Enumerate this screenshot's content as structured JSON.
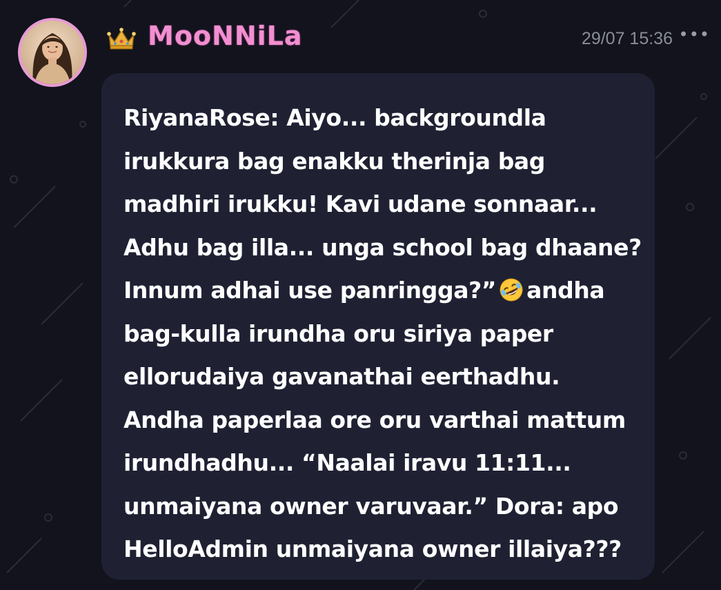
{
  "post": {
    "author": "MooNNiLa",
    "timestamp": "29/07 15:36",
    "more_icon": "more-horizontal-icon",
    "badge_icon": "crown-icon",
    "message_lines": [
      "RiyanaRose: Aiyo... backgroundla",
      "irukkura bag enakku therinja bag",
      "madhiri irukku! Kavi udane sonnaar...",
      "Adhu bag illa... unga school bag dhaane?",
      "Innum adhai use panringga?”",
      "andha",
      "bag-kulla irundha oru siriya paper",
      "ellorudaiya gavanathai eerthadhu.",
      "Andha paperlaa ore oru varthai mattum",
      "irundhadhu... “Naalai iravu 11:11...",
      "unmaiyana owner varuvaar.”  Dora: apo",
      "HelloAdmin unmaiyana owner illaiya???"
    ],
    "emoji": "rolling-on-floor-laughing-emoji"
  },
  "colors": {
    "background": "#12131c",
    "bubble": "#1f2133",
    "username": "#f28fd0",
    "avatar_border": "#e89ad6",
    "timestamp": "#8a8d98"
  }
}
